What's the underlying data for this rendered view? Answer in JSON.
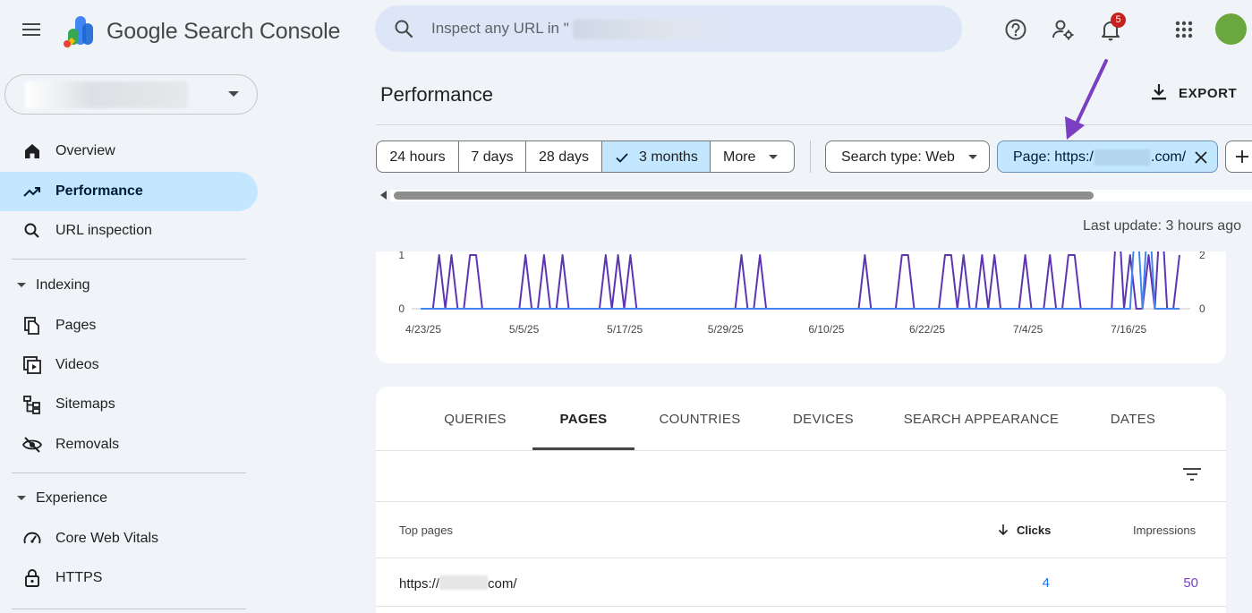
{
  "app": {
    "title": "Google Search Console"
  },
  "search": {
    "placeholder": "Inspect any URL in \""
  },
  "header": {
    "notification_count": "5",
    "icons": [
      "help-icon",
      "manage-accounts-icon",
      "notifications-icon",
      "apps-icon"
    ]
  },
  "sidebar": {
    "items": [
      {
        "label": "Overview",
        "icon": "home-icon"
      },
      {
        "label": "Performance",
        "icon": "trending-up-icon",
        "active": true
      },
      {
        "label": "URL inspection",
        "icon": "search-icon"
      }
    ],
    "sections": [
      {
        "label": "Indexing",
        "items": [
          {
            "label": "Pages",
            "icon": "pages-icon"
          },
          {
            "label": "Videos",
            "icon": "videos-icon"
          },
          {
            "label": "Sitemaps",
            "icon": "sitemaps-icon"
          },
          {
            "label": "Removals",
            "icon": "removals-icon"
          }
        ]
      },
      {
        "label": "Experience",
        "items": [
          {
            "label": "Core Web Vitals",
            "icon": "speed-icon"
          },
          {
            "label": "HTTPS",
            "icon": "lock-icon"
          }
        ]
      }
    ]
  },
  "main": {
    "title": "Performance",
    "export_label": "EXPORT",
    "date_ranges": [
      {
        "label": "24 hours"
      },
      {
        "label": "7 days"
      },
      {
        "label": "28 days"
      },
      {
        "label": "3 months",
        "selected": true
      },
      {
        "label": "More"
      }
    ],
    "filters": {
      "search_type": "Search type: Web",
      "page_prefix": "Page: https:/",
      "page_suffix": ".com/"
    },
    "last_update": "Last update: 3 hours ago"
  },
  "chart_data": {
    "type": "line",
    "x_tick_labels": [
      "4/23/25",
      "5/5/25",
      "5/17/25",
      "5/29/25",
      "6/10/25",
      "6/22/25",
      "7/4/25",
      "7/16/25"
    ],
    "y_left_ticks": [
      "0",
      "1"
    ],
    "y_right_ticks": [
      "0",
      "2"
    ],
    "series": [
      {
        "color": "#5e35b1",
        "axis": "left",
        "values": [
          0,
          0,
          0,
          1,
          0,
          1,
          0,
          0,
          1,
          1,
          0,
          0,
          0,
          0,
          0,
          0,
          0,
          1,
          0,
          0,
          1,
          0,
          0,
          1,
          0,
          0,
          0,
          0,
          0,
          0,
          1,
          0,
          1,
          0,
          1,
          0,
          0,
          0,
          0,
          0,
          0,
          0,
          0,
          0,
          0,
          0,
          0,
          0,
          0,
          0,
          0,
          0,
          1,
          0,
          0,
          1,
          0,
          0,
          0,
          0,
          0,
          0,
          0,
          0,
          0,
          0,
          0,
          0,
          0,
          0,
          0,
          0,
          1,
          0,
          0,
          0,
          0,
          0,
          1,
          1,
          0,
          0,
          0,
          0,
          0,
          1,
          1,
          0,
          1,
          0,
          0,
          1,
          0,
          1,
          0,
          0,
          0,
          0,
          1,
          0,
          0,
          0,
          1,
          0,
          0,
          1,
          1,
          0,
          0,
          0,
          0,
          0,
          0,
          2,
          0,
          1,
          0,
          0,
          1,
          0,
          2,
          0,
          0,
          1
        ]
      },
      {
        "color": "#4285f4",
        "axis": "right",
        "values": [
          0,
          0,
          0,
          0,
          0,
          0,
          0,
          0,
          0,
          0,
          0,
          0,
          0,
          0,
          0,
          0,
          0,
          0,
          0,
          0,
          0,
          0,
          0,
          0,
          0,
          0,
          0,
          0,
          0,
          0,
          0,
          0,
          0,
          0,
          0,
          0,
          0,
          0,
          0,
          0,
          0,
          0,
          0,
          0,
          0,
          0,
          0,
          0,
          0,
          0,
          0,
          0,
          0,
          0,
          0,
          0,
          0,
          0,
          0,
          0,
          0,
          0,
          0,
          0,
          0,
          0,
          0,
          0,
          0,
          0,
          0,
          0,
          0,
          0,
          0,
          0,
          0,
          0,
          0,
          0,
          0,
          0,
          0,
          0,
          0,
          0,
          0,
          0,
          0,
          0,
          0,
          0,
          0,
          0,
          0,
          0,
          0,
          0,
          0,
          0,
          0,
          0,
          0,
          0,
          0,
          0,
          0,
          0,
          0,
          0,
          0,
          0,
          0,
          0,
          0,
          0,
          4,
          0,
          4,
          0,
          0,
          0,
          0,
          0
        ]
      }
    ]
  },
  "table": {
    "tabs": [
      "QUERIES",
      "PAGES",
      "COUNTRIES",
      "DEVICES",
      "SEARCH APPEARANCE",
      "DATES"
    ],
    "active_tab": "PAGES",
    "columns": {
      "top": "Top pages",
      "clicks": "Clicks",
      "impressions": "Impressions"
    },
    "rows": [
      {
        "url_prefix": "https://",
        "url_suffix": "com/",
        "clicks": "4",
        "impressions": "50"
      }
    ]
  },
  "colors": {
    "accent": "#c2e7ff",
    "clicks": "#1a73e8",
    "impressions": "#7b3fc4",
    "annotation_arrow": "#7b3fc4"
  }
}
